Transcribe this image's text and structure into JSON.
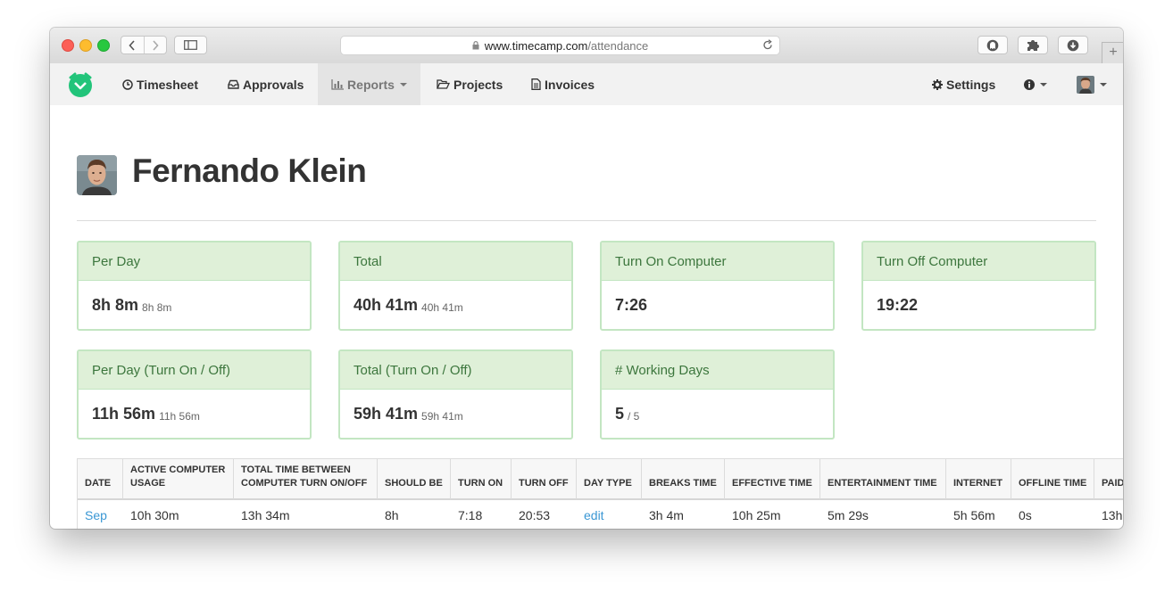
{
  "browser": {
    "url_host": "www.timecamp.com",
    "url_path": "/attendance"
  },
  "nav": {
    "timesheet": "Timesheet",
    "approvals": "Approvals",
    "reports": "Reports",
    "projects": "Projects",
    "invoices": "Invoices",
    "settings": "Settings"
  },
  "user": {
    "name": "Fernando Klein"
  },
  "cards": [
    {
      "title": "Per Day",
      "value": "8h 8m",
      "sub": "8h 8m"
    },
    {
      "title": "Total",
      "value": "40h 41m",
      "sub": "40h 41m"
    },
    {
      "title": "Turn On Computer",
      "value": "7:26",
      "sub": ""
    },
    {
      "title": "Turn Off Computer",
      "value": "19:22",
      "sub": ""
    },
    {
      "title": "Per Day (Turn On / Off)",
      "value": "11h 56m",
      "sub": "11h 56m"
    },
    {
      "title": "Total (Turn On / Off)",
      "value": "59h 41m",
      "sub": "59h 41m"
    },
    {
      "title": "# Working Days",
      "value": "5",
      "sub": "/ 5"
    }
  ],
  "table": {
    "headers": [
      "DATE",
      "ACTIVE COMPUTER USAGE",
      "TOTAL TIME BETWEEN COMPUTER TURN ON/OFF",
      "SHOULD BE",
      "TURN ON",
      "TURN OFF",
      "DAY TYPE",
      "BREAKS TIME",
      "EFFECTIVE TIME",
      "ENTERTAINMENT TIME",
      "INTERNET",
      "OFFLINE TIME",
      "PAID"
    ],
    "header_lines": [
      [
        "DATE"
      ],
      [
        "ACTIVE COMPUTER",
        "USAGE"
      ],
      [
        "TOTAL TIME BETWEEN",
        "COMPUTER TURN ON/OFF"
      ],
      [
        "SHOULD BE"
      ],
      [
        "TURN ON"
      ],
      [
        "TURN OFF"
      ],
      [
        "DAY TYPE"
      ],
      [
        "BREAKS TIME"
      ],
      [
        "EFFECTIVE TIME"
      ],
      [
        "ENTERTAINMENT TIME"
      ],
      [
        "INTERNET"
      ],
      [
        "OFFLINE TIME"
      ],
      [
        "PAID"
      ]
    ],
    "rows": [
      [
        "Sep",
        "10h 30m",
        "13h 34m",
        "8h",
        "7:18",
        "20:53",
        "edit",
        "3h 4m",
        "10h 25m",
        "5m 29s",
        "5h 56m",
        "0s",
        "13h"
      ]
    ]
  },
  "colors": {
    "card_header_bg": "#dff0d8",
    "card_border": "#c3e6c2",
    "card_title": "#3c763d",
    "link": "#3a97d4",
    "logo": "#22c47a"
  }
}
